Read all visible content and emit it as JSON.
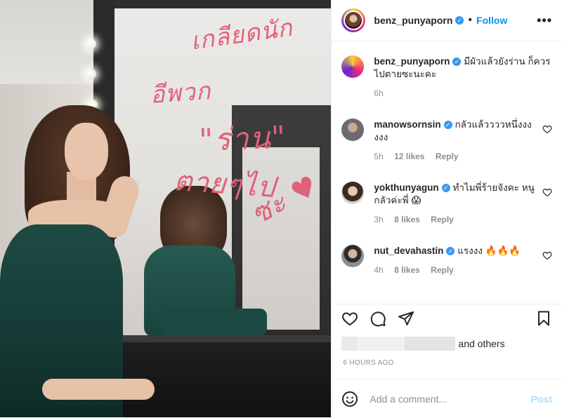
{
  "post": {
    "author": "benz_punyaporn",
    "follow_label": "Follow",
    "more_label": "•••",
    "mirror_writing": [
      "เกลียดนัก",
      "อีพวก",
      "\"ร่าน\"",
      "ตายๆไป",
      "ซะ ♥"
    ]
  },
  "caption": {
    "username": "benz_punyaporn",
    "text": "มีผัวแล้วยังร่าน ก็ควรไปตายซะนะคะ",
    "time": "6h"
  },
  "comments": [
    {
      "username": "manowsornsin",
      "text": "กลัวแล้ววววหนึ่งงงงงง",
      "time": "5h",
      "likes": "12 likes",
      "reply": "Reply"
    },
    {
      "username": "yokthunyagun",
      "text": "ทำไมพี่ร้ายจังคะ หนูกลัวค่ะพี่ 😱",
      "time": "3h",
      "likes": "8 likes",
      "reply": "Reply"
    },
    {
      "username": "nut_devahastin",
      "text": "แรงงง 🔥🔥🔥",
      "time": "4h",
      "likes": "8 likes",
      "reply": "Reply"
    }
  ],
  "likes_suffix": "and others",
  "timestamp": "6 HOURS AGO",
  "add_comment": {
    "placeholder": "Add a comment...",
    "post_label": "Post"
  },
  "colors": {
    "accent": "#0095f6",
    "post_disabled": "#b2dffc",
    "verified": "#3897f0",
    "mirror_lipstick": "#e0627a"
  }
}
